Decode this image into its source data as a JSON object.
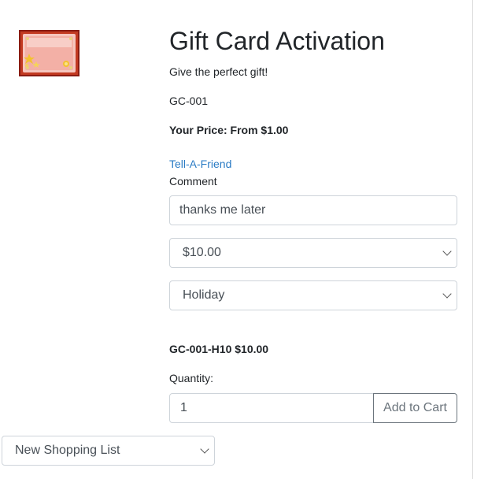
{
  "product": {
    "title": "Gift Card Activation",
    "description": "Give the perfect gift!",
    "sku": "GC-001",
    "price_label": "Your Price:",
    "price_value": "From $1.00"
  },
  "links": {
    "tell_a_friend": "Tell-A-Friend"
  },
  "form": {
    "comment_label": "Comment",
    "comment_value": "thanks me later",
    "amount_selected": "$10.00",
    "design_selected": "Holiday",
    "variant_sku_price": "GC-001-H10 $10.00",
    "quantity_label": "Quantity:",
    "quantity_value": "1",
    "add_to_cart_label": "Add to Cart"
  },
  "shopping_list": {
    "selected": "New Shopping List"
  },
  "colors": {
    "link": "#2a7bc4",
    "card_frame": "#9e2418",
    "card_face": "#f4b8b0",
    "stars": "#f2c230"
  },
  "icons": {
    "product_image": "gift-card-image",
    "select_chevron": "chevron-down-icon"
  }
}
